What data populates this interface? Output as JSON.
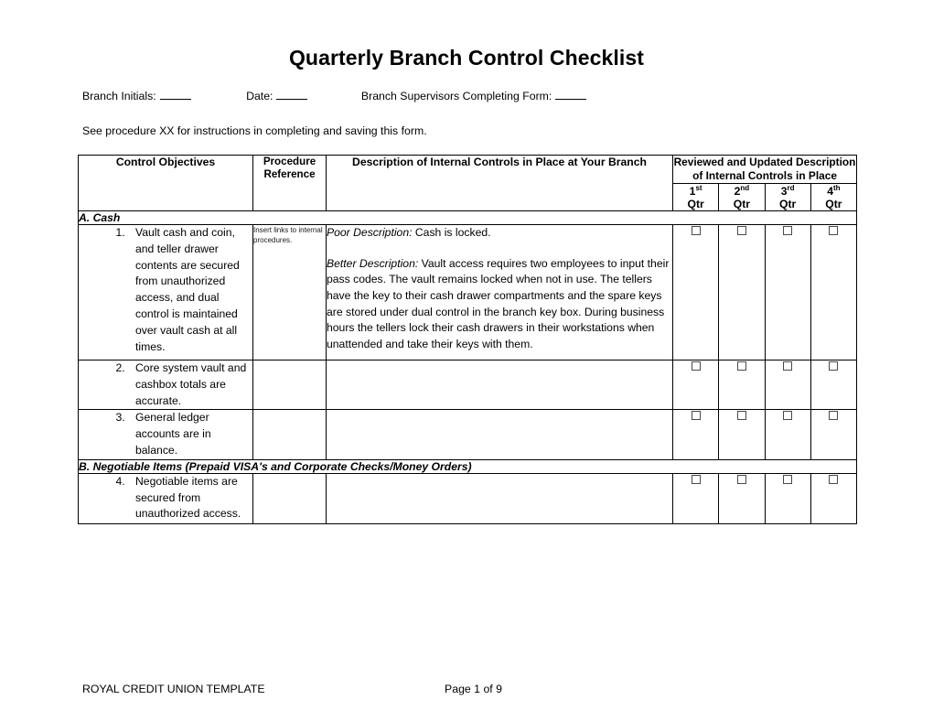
{
  "document": {
    "title": "Quarterly Branch Control Checklist",
    "instruction": "See procedure XX for instructions in completing and saving this form."
  },
  "meta": {
    "branch_initials_label": "Branch Initials:",
    "branch_initials_value": "",
    "date_label": "Date:",
    "date_value": "",
    "supervisors_label": "Branch Supervisors Completing Form:",
    "supervisors_value": ""
  },
  "table": {
    "headers": {
      "control_objectives": "Control Objectives",
      "procedure_reference": "Procedure Reference",
      "description": "Description of Internal Controls in Place at Your Branch",
      "reviewed_group": "Reviewed and Updated Description of Internal Controls in Place",
      "quarters": [
        {
          "ordinal": "1",
          "suffix": "st",
          "unit": "Qtr"
        },
        {
          "ordinal": "2",
          "suffix": "nd",
          "unit": "Qtr"
        },
        {
          "ordinal": "3",
          "suffix": "rd",
          "unit": "Qtr"
        },
        {
          "ordinal": "4",
          "suffix": "th",
          "unit": "Qtr"
        }
      ]
    },
    "sections": [
      {
        "id": "a",
        "label": "A. Cash"
      },
      {
        "id": "b",
        "label": "B. Negotiable Items (Prepaid VISA's and Corporate Checks/Money Orders)"
      }
    ],
    "rows": [
      {
        "number": "1.",
        "objective": "Vault cash and coin, and teller drawer contents are secured from unauthorized access, and dual control is maintained over vault cash at all times.",
        "procedure_reference": "Insert links to internal procedures.",
        "description_poor_label": "Poor Description:",
        "description_poor_text": " Cash is locked.",
        "description_better_label": "Better Description:",
        "description_better_text": " Vault access requires two employees to input their pass codes.  The vault remains locked when not in use.  The tellers have the key to their cash drawer compartments and the spare keys are stored under dual control in the branch key box.  During business hours the tellers lock their cash drawers in their workstations when unattended and take their keys with them.",
        "q1": "",
        "q2": "",
        "q3": "",
        "q4": ""
      },
      {
        "number": "2.",
        "objective": "Core system vault and cashbox totals are accurate.",
        "procedure_reference": "",
        "description_poor_label": "",
        "description_poor_text": "",
        "description_better_label": "",
        "description_better_text": "",
        "q1": "",
        "q2": "",
        "q3": "",
        "q4": ""
      },
      {
        "number": "3.",
        "objective": "General ledger accounts are in balance.",
        "procedure_reference": "",
        "description_poor_label": "",
        "description_poor_text": "",
        "description_better_label": "",
        "description_better_text": "",
        "q1": "",
        "q2": "",
        "q3": "",
        "q4": ""
      },
      {
        "number": "4.",
        "objective": "Negotiable items are secured from unauthorized access.",
        "procedure_reference": "",
        "description_poor_label": "",
        "description_poor_text": "",
        "description_better_label": "",
        "description_better_text": "",
        "q1": "",
        "q2": "",
        "q3": "",
        "q4": ""
      }
    ]
  },
  "footer": {
    "left": "ROYAL CREDIT UNION TEMPLATE",
    "page": "Page 1 of 9"
  },
  "colors": {
    "header_blue": "#8AB0E3",
    "section_blue": "#B8CCE4",
    "border": "#000000"
  }
}
